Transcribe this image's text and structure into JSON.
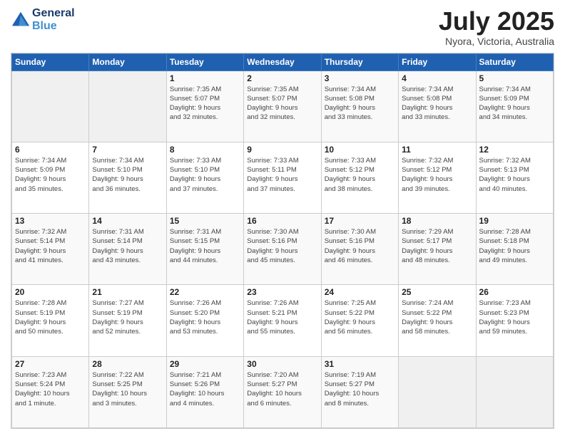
{
  "header": {
    "logo_line1": "General",
    "logo_line2": "Blue",
    "month": "July 2025",
    "location": "Nyora, Victoria, Australia"
  },
  "weekdays": [
    "Sunday",
    "Monday",
    "Tuesday",
    "Wednesday",
    "Thursday",
    "Friday",
    "Saturday"
  ],
  "weeks": [
    [
      {
        "day": "",
        "info": ""
      },
      {
        "day": "",
        "info": ""
      },
      {
        "day": "1",
        "info": "Sunrise: 7:35 AM\nSunset: 5:07 PM\nDaylight: 9 hours\nand 32 minutes."
      },
      {
        "day": "2",
        "info": "Sunrise: 7:35 AM\nSunset: 5:07 PM\nDaylight: 9 hours\nand 32 minutes."
      },
      {
        "day": "3",
        "info": "Sunrise: 7:34 AM\nSunset: 5:08 PM\nDaylight: 9 hours\nand 33 minutes."
      },
      {
        "day": "4",
        "info": "Sunrise: 7:34 AM\nSunset: 5:08 PM\nDaylight: 9 hours\nand 33 minutes."
      },
      {
        "day": "5",
        "info": "Sunrise: 7:34 AM\nSunset: 5:09 PM\nDaylight: 9 hours\nand 34 minutes."
      }
    ],
    [
      {
        "day": "6",
        "info": "Sunrise: 7:34 AM\nSunset: 5:09 PM\nDaylight: 9 hours\nand 35 minutes."
      },
      {
        "day": "7",
        "info": "Sunrise: 7:34 AM\nSunset: 5:10 PM\nDaylight: 9 hours\nand 36 minutes."
      },
      {
        "day": "8",
        "info": "Sunrise: 7:33 AM\nSunset: 5:10 PM\nDaylight: 9 hours\nand 37 minutes."
      },
      {
        "day": "9",
        "info": "Sunrise: 7:33 AM\nSunset: 5:11 PM\nDaylight: 9 hours\nand 37 minutes."
      },
      {
        "day": "10",
        "info": "Sunrise: 7:33 AM\nSunset: 5:12 PM\nDaylight: 9 hours\nand 38 minutes."
      },
      {
        "day": "11",
        "info": "Sunrise: 7:32 AM\nSunset: 5:12 PM\nDaylight: 9 hours\nand 39 minutes."
      },
      {
        "day": "12",
        "info": "Sunrise: 7:32 AM\nSunset: 5:13 PM\nDaylight: 9 hours\nand 40 minutes."
      }
    ],
    [
      {
        "day": "13",
        "info": "Sunrise: 7:32 AM\nSunset: 5:14 PM\nDaylight: 9 hours\nand 41 minutes."
      },
      {
        "day": "14",
        "info": "Sunrise: 7:31 AM\nSunset: 5:14 PM\nDaylight: 9 hours\nand 43 minutes."
      },
      {
        "day": "15",
        "info": "Sunrise: 7:31 AM\nSunset: 5:15 PM\nDaylight: 9 hours\nand 44 minutes."
      },
      {
        "day": "16",
        "info": "Sunrise: 7:30 AM\nSunset: 5:16 PM\nDaylight: 9 hours\nand 45 minutes."
      },
      {
        "day": "17",
        "info": "Sunrise: 7:30 AM\nSunset: 5:16 PM\nDaylight: 9 hours\nand 46 minutes."
      },
      {
        "day": "18",
        "info": "Sunrise: 7:29 AM\nSunset: 5:17 PM\nDaylight: 9 hours\nand 48 minutes."
      },
      {
        "day": "19",
        "info": "Sunrise: 7:28 AM\nSunset: 5:18 PM\nDaylight: 9 hours\nand 49 minutes."
      }
    ],
    [
      {
        "day": "20",
        "info": "Sunrise: 7:28 AM\nSunset: 5:19 PM\nDaylight: 9 hours\nand 50 minutes."
      },
      {
        "day": "21",
        "info": "Sunrise: 7:27 AM\nSunset: 5:19 PM\nDaylight: 9 hours\nand 52 minutes."
      },
      {
        "day": "22",
        "info": "Sunrise: 7:26 AM\nSunset: 5:20 PM\nDaylight: 9 hours\nand 53 minutes."
      },
      {
        "day": "23",
        "info": "Sunrise: 7:26 AM\nSunset: 5:21 PM\nDaylight: 9 hours\nand 55 minutes."
      },
      {
        "day": "24",
        "info": "Sunrise: 7:25 AM\nSunset: 5:22 PM\nDaylight: 9 hours\nand 56 minutes."
      },
      {
        "day": "25",
        "info": "Sunrise: 7:24 AM\nSunset: 5:22 PM\nDaylight: 9 hours\nand 58 minutes."
      },
      {
        "day": "26",
        "info": "Sunrise: 7:23 AM\nSunset: 5:23 PM\nDaylight: 9 hours\nand 59 minutes."
      }
    ],
    [
      {
        "day": "27",
        "info": "Sunrise: 7:23 AM\nSunset: 5:24 PM\nDaylight: 10 hours\nand 1 minute."
      },
      {
        "day": "28",
        "info": "Sunrise: 7:22 AM\nSunset: 5:25 PM\nDaylight: 10 hours\nand 3 minutes."
      },
      {
        "day": "29",
        "info": "Sunrise: 7:21 AM\nSunset: 5:26 PM\nDaylight: 10 hours\nand 4 minutes."
      },
      {
        "day": "30",
        "info": "Sunrise: 7:20 AM\nSunset: 5:27 PM\nDaylight: 10 hours\nand 6 minutes."
      },
      {
        "day": "31",
        "info": "Sunrise: 7:19 AM\nSunset: 5:27 PM\nDaylight: 10 hours\nand 8 minutes."
      },
      {
        "day": "",
        "info": ""
      },
      {
        "day": "",
        "info": ""
      }
    ]
  ]
}
